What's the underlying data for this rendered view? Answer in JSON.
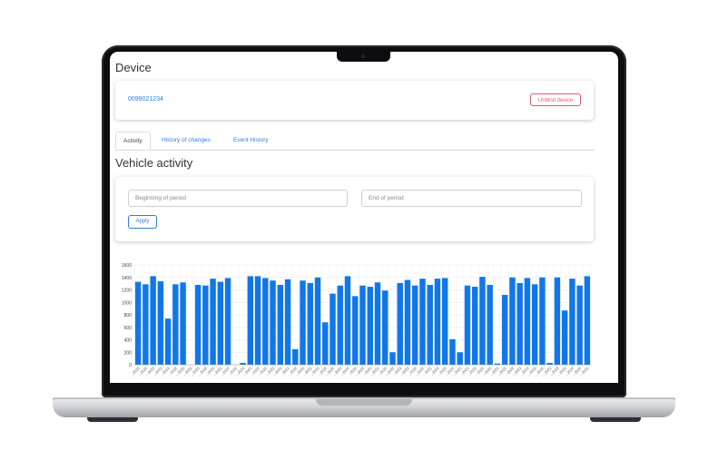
{
  "page": {
    "title": "Device",
    "device_id": "0099021234",
    "unbind_label": "Unbind device",
    "tabs": [
      {
        "label": "Activity",
        "active": true
      },
      {
        "label": "History of changes",
        "active": false
      },
      {
        "label": "Event History",
        "active": false
      }
    ],
    "section_title": "Vehicle activity",
    "filter": {
      "start_placeholder": "Beginning of period",
      "end_placeholder": "End of period",
      "apply_label": "Apply"
    }
  },
  "colors": {
    "accent": "#2f7de1",
    "danger": "#e05a73",
    "bar": "#1177e8"
  },
  "chart_data": {
    "type": "bar",
    "ylim": [
      0,
      1600
    ],
    "yticks": [
      0,
      200,
      400,
      600,
      800,
      1000,
      1200,
      1400,
      1600
    ],
    "grid": true,
    "legend": "none",
    "x_tick_label": "…2022",
    "values": [
      1330,
      1290,
      1420,
      1340,
      740,
      1290,
      1320,
      0,
      1280,
      1270,
      1380,
      1330,
      1390,
      0,
      30,
      1420,
      1420,
      1390,
      1350,
      1280,
      1370,
      250,
      1350,
      1310,
      1400,
      680,
      1140,
      1270,
      1420,
      1100,
      1270,
      1250,
      1320,
      1190,
      200,
      1310,
      1360,
      1270,
      1380,
      1280,
      1380,
      1390,
      410,
      200,
      1270,
      1250,
      1410,
      1280,
      20,
      1120,
      1400,
      1310,
      1390,
      1290,
      1400,
      30,
      1400,
      870,
      1380,
      1270,
      1420
    ]
  }
}
